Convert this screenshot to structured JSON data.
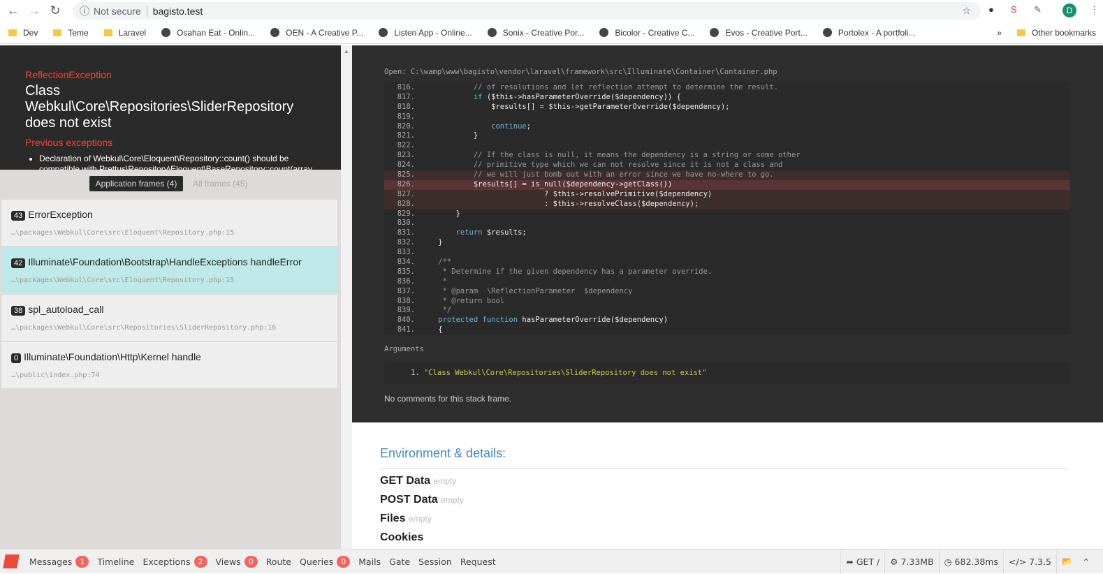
{
  "browser": {
    "security": "Not secure",
    "url": "bagisto.test",
    "avatar": "D",
    "bookmarks": [
      {
        "label": "Dev",
        "type": "folder"
      },
      {
        "label": "Teme",
        "type": "folder"
      },
      {
        "label": "Laravel",
        "type": "folder"
      },
      {
        "label": "Osahan Eat - Onlin...",
        "type": "site"
      },
      {
        "label": "OEN - A Creative P...",
        "type": "site"
      },
      {
        "label": "Listen App - Online...",
        "type": "site"
      },
      {
        "label": "Sonix - Creative Por...",
        "type": "site"
      },
      {
        "label": "Bicolor - Creative C...",
        "type": "site"
      },
      {
        "label": "Evos - Creative Port...",
        "type": "site"
      },
      {
        "label": "Portolex - A portfoli...",
        "type": "site"
      }
    ],
    "more": "»",
    "other_bookmarks": "Other bookmarks"
  },
  "exception": {
    "type": "ReflectionException",
    "message": "Class Webkul\\Core\\Repositories\\SliderRepository does not exist",
    "previous_title": "Previous exceptions",
    "previous": [
      "Declaration of Webkul\\Core\\Eloquent\\Repository::count() should be compatible with Prettus\\Repository\\Eloquent\\BaseRepository::count(array"
    ]
  },
  "frame_tabs": {
    "application": "Application frames (4)",
    "all": "All frames (45)"
  },
  "frames": [
    {
      "num": "43",
      "cls": "ErrorException",
      "path": "…\\packages\\Webkul\\Core\\src\\Eloquent\\Repository.php:15",
      "active": false
    },
    {
      "num": "42",
      "cls": "Illuminate\\Foundation\\Bootstrap\\HandleExceptions handleError",
      "path": "…\\packages\\Webkul\\Core\\src\\Eloquent\\Repository.php:15",
      "active": true
    },
    {
      "num": "38",
      "cls": "spl_autoload_call",
      "path": "…\\packages\\Webkul\\Core\\src\\Repositories\\SliderRepository.php:16",
      "active": false
    },
    {
      "num": "0",
      "cls": "Illuminate\\Foundation\\Http\\Kernel handle",
      "path": "…\\public\\index.php:74",
      "active": false
    }
  ],
  "code": {
    "open": "Open: C:\\wamp\\www\\bagisto\\vendor\\laravel\\framework\\src\\Illuminate\\Container\\Container.php",
    "lines": [
      {
        "n": "816.",
        "s": [
          [
            "c",
            "            // of resolutions and let reflection attempt to determine the result."
          ]
        ]
      },
      {
        "n": "817.",
        "s": [
          [
            "k",
            "            if "
          ],
          [
            "p",
            "($this->hasParameterOverride($dependency)) {"
          ]
        ]
      },
      {
        "n": "818.",
        "s": [
          [
            "p",
            "                $results[] = $this->getParameterOverride($dependency);"
          ]
        ]
      },
      {
        "n": "819.",
        "s": []
      },
      {
        "n": "820.",
        "s": [
          [
            "k",
            "                continue"
          ],
          [
            "p",
            ";"
          ]
        ]
      },
      {
        "n": "821.",
        "s": [
          [
            "p",
            "            }"
          ]
        ]
      },
      {
        "n": "822.",
        "s": []
      },
      {
        "n": "823.",
        "s": [
          [
            "c",
            "            // If the class is null, it means the dependency is a string or some other"
          ]
        ]
      },
      {
        "n": "824.",
        "s": [
          [
            "c",
            "            // primitive type which we can not resolve since it is not a class and"
          ]
        ]
      },
      {
        "n": "825.",
        "s": [
          [
            "c",
            "            // we will just bomb out with an error since we have no-where to go."
          ]
        ],
        "hl": "hl1"
      },
      {
        "n": "826.",
        "s": [
          [
            "p",
            "            $results[] = is_null($dependency->getClass())"
          ]
        ],
        "hl": "hl2"
      },
      {
        "n": "827.",
        "s": [
          [
            "p",
            "                            ? $this->resolvePrimitive($dependency)"
          ]
        ],
        "hl": "hl1"
      },
      {
        "n": "828.",
        "s": [
          [
            "p",
            "                            : $this->resolveClass($dependency);"
          ]
        ],
        "hl": "hl1"
      },
      {
        "n": "829.",
        "s": [
          [
            "p",
            "        }"
          ]
        ]
      },
      {
        "n": "830.",
        "s": []
      },
      {
        "n": "831.",
        "s": [
          [
            "k",
            "        return "
          ],
          [
            "p",
            "$results;"
          ]
        ]
      },
      {
        "n": "832.",
        "s": [
          [
            "p",
            "    }"
          ]
        ]
      },
      {
        "n": "833.",
        "s": []
      },
      {
        "n": "834.",
        "s": [
          [
            "c",
            "    /**"
          ]
        ]
      },
      {
        "n": "835.",
        "s": [
          [
            "c",
            "     * Determine if the given dependency has a parameter override."
          ]
        ]
      },
      {
        "n": "836.",
        "s": [
          [
            "c",
            "     *"
          ]
        ]
      },
      {
        "n": "837.",
        "s": [
          [
            "c",
            "     * @param  \\ReflectionParameter  $dependency"
          ]
        ]
      },
      {
        "n": "838.",
        "s": [
          [
            "c",
            "     * @return bool"
          ]
        ]
      },
      {
        "n": "839.",
        "s": [
          [
            "c",
            "     */"
          ]
        ]
      },
      {
        "n": "840.",
        "s": [
          [
            "k",
            "    protected function "
          ],
          [
            "p",
            "hasParameterOverride($dependency)"
          ]
        ]
      },
      {
        "n": "841.",
        "s": [
          [
            "p",
            "    {"
          ]
        ]
      }
    ]
  },
  "arguments": {
    "label": "Arguments",
    "items": [
      {
        "index": "1.",
        "value": "\"Class Webkul\\Core\\Repositories\\SliderRepository does not exist\""
      }
    ]
  },
  "no_comments": "No comments for this stack frame.",
  "env": {
    "title": "Environment & details:",
    "rows": [
      {
        "label": "GET Data",
        "note": "empty"
      },
      {
        "label": "POST Data",
        "note": "empty"
      },
      {
        "label": "Files",
        "note": "empty"
      },
      {
        "label": "Cookies",
        "note": ""
      }
    ]
  },
  "debugbar": {
    "tabs": [
      {
        "label": "Messages",
        "badge": "1"
      },
      {
        "label": "Timeline"
      },
      {
        "label": "Exceptions",
        "badge": "2"
      },
      {
        "label": "Views",
        "badge": "0"
      },
      {
        "label": "Route"
      },
      {
        "label": "Queries",
        "badge": "0"
      },
      {
        "label": "Mails"
      },
      {
        "label": "Gate"
      },
      {
        "label": "Session"
      },
      {
        "label": "Request"
      }
    ],
    "method": "GET /",
    "memory": "7.33MB",
    "time": "682.38ms",
    "php": "7.3.5"
  }
}
